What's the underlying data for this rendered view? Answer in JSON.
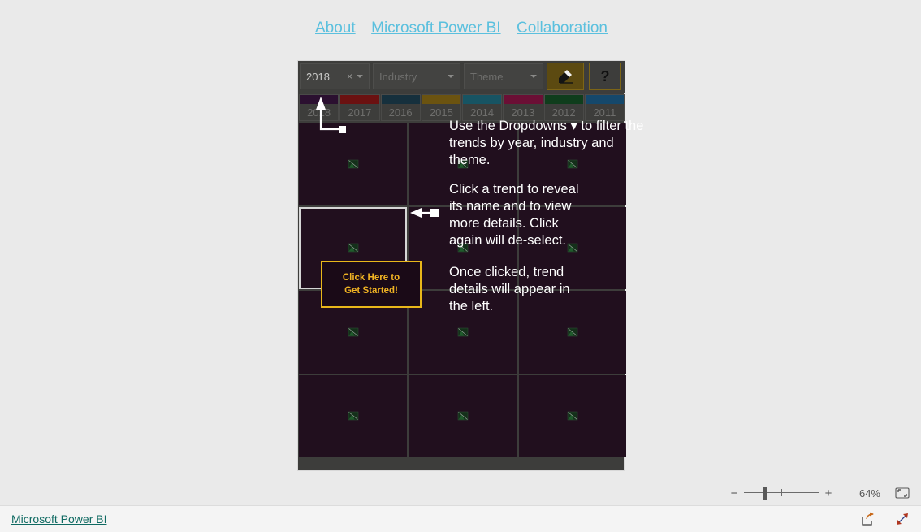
{
  "topnav": {
    "links": [
      {
        "label": "About"
      },
      {
        "label": "Microsoft Power BI"
      },
      {
        "label": "Collaboration"
      }
    ]
  },
  "toolbar": {
    "year_slicer": {
      "value": "2018",
      "clear": "×"
    },
    "industry_slicer": {
      "placeholder": "Industry"
    },
    "theme_slicer": {
      "placeholder": "Theme"
    },
    "eraser_button": {
      "tooltip": "Clear filters"
    },
    "help_button": {
      "label": "?"
    }
  },
  "year_strip": {
    "years": [
      {
        "label": "2018",
        "color": "#2b1030"
      },
      {
        "label": "2017",
        "color": "#6b1111"
      },
      {
        "label": "2016",
        "color": "#16303d"
      },
      {
        "label": "2015",
        "color": "#6b5310"
      },
      {
        "label": "2014",
        "color": "#175463"
      },
      {
        "label": "2013",
        "color": "#6b0f35"
      },
      {
        "label": "2012",
        "color": "#0f3d1c"
      },
      {
        "label": "2011",
        "color": "#15486b"
      }
    ]
  },
  "grid": {
    "rows": 4,
    "columns": 3,
    "tile_color": "#210f1e",
    "selected_index": 3,
    "placeholder_icon": "broken-image-icon"
  },
  "annotations": {
    "dropdowns": "Use the Dropdowns  ▾  to filter the\ntrends by year, industry and theme.",
    "click_trend": "Click a trend to reveal\nits name and to view\nmore details. Click\nagain will de-select.",
    "trend_details": "Once clicked, trend\ndetails will appear in\nthe left."
  },
  "get_started_button": {
    "line1": "Click Here to",
    "line2": "Get Started!",
    "border_color": "#e8b71a",
    "text_color": "#f0b323"
  },
  "statusbar": {
    "minus": "−",
    "plus": "+",
    "zoom_level": "64%",
    "fit_icon": "fit-to-screen-icon"
  },
  "footer": {
    "link": "Microsoft Power BI",
    "share_icon": "share-icon",
    "fullscreen_icon": "fullscreen-icon"
  },
  "colors": {
    "page_background": "#eaeaea",
    "canvas_background": "#3d3d3b",
    "accent_link": "#5bc0de",
    "footer_link": "#0f6a62",
    "highlight": "#f0b323"
  }
}
